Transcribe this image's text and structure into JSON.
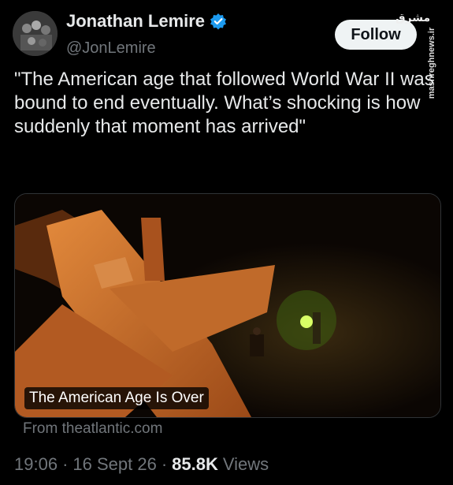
{
  "author": {
    "name": "Jonathan Lemire",
    "handle": "@JonLemire"
  },
  "follow_label": "Follow",
  "watermark": {
    "logo": "مشرق",
    "site": "mashreghnews.ir"
  },
  "tweet_text": "\"The American age that followed World War II was bound to end eventually. What’s shocking is how suddenly that moment has arrived\"",
  "card": {
    "title": "The American Age Is Over",
    "source": "From theatlantic.com"
  },
  "meta": {
    "time": "19:06",
    "date": "16 Sept 26",
    "views_count": "85.8K",
    "views_label": "Views",
    "separator": "·"
  },
  "colors": {
    "background": "#000000",
    "text": "#e7e9ea",
    "muted": "#71767b",
    "verified": "#1d9bf0"
  },
  "icons": {
    "verified": "verified-badge-icon"
  }
}
